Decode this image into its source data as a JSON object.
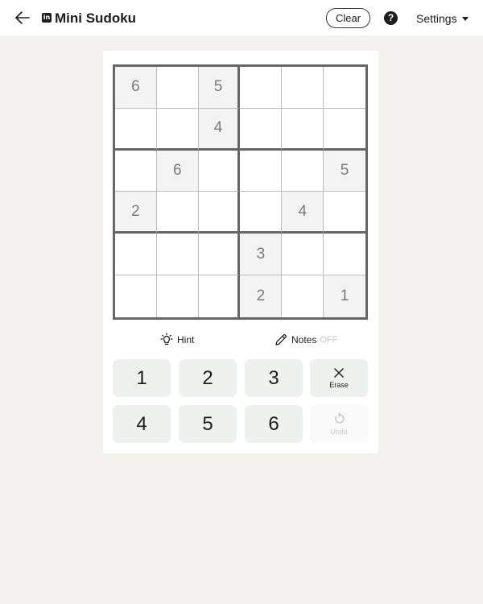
{
  "header": {
    "title": "Mini Sudoku",
    "clear_label": "Clear",
    "help_label": "?",
    "settings_label": "Settings",
    "brand_label": "in"
  },
  "board": {
    "size": 6,
    "rows": [
      [
        "6",
        "",
        "5",
        "",
        "",
        ""
      ],
      [
        "",
        "",
        "4",
        "",
        "",
        ""
      ],
      [
        "",
        "6",
        "",
        "",
        "",
        "5"
      ],
      [
        "2",
        "",
        "",
        "",
        "4",
        ""
      ],
      [
        "",
        "",
        "",
        "3",
        "",
        ""
      ],
      [
        "",
        "",
        "",
        "2",
        "",
        "1"
      ]
    ]
  },
  "tools": {
    "hint_label": "Hint",
    "notes_label": "Notes",
    "notes_state": "OFF"
  },
  "keypad": {
    "numbers": [
      "1",
      "2",
      "3",
      "4",
      "5",
      "6"
    ],
    "erase_label": "Erase",
    "undo_label": "Undo"
  },
  "icons": {
    "back": "arrow-left-icon",
    "hint": "lightbulb-icon",
    "notes": "pencil-icon",
    "erase": "close-icon",
    "undo": "undo-icon"
  },
  "colors": {
    "background": "#f3f2ef",
    "board_border": "#666666",
    "given_cell": "#f3f3f3",
    "key_bg": "#eef2ef",
    "notes_off": "#c8c8c8"
  }
}
